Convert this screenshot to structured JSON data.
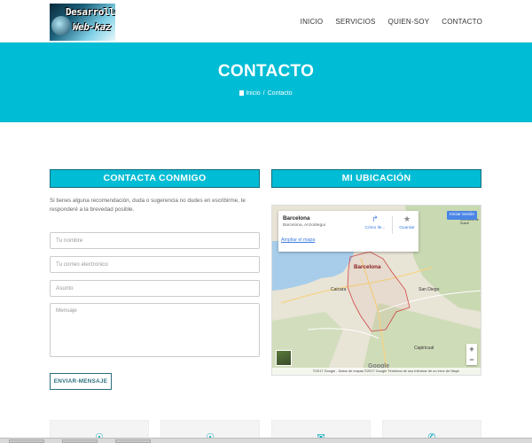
{
  "header": {
    "logo_line1": "Desarrollo",
    "logo_line2": "Web-kaz",
    "nav": [
      "INICIO",
      "SERVICIOS",
      "QUIEN-SOY",
      "CONTACTO"
    ]
  },
  "banner": {
    "title": "CONTACTO",
    "breadcrumb_home": "Inicio",
    "breadcrumb_sep": "/",
    "breadcrumb_current": "Contacto"
  },
  "contact": {
    "title": "CONTACTA CONMIGO",
    "intro": "Si tienes alguna recomendación, duda o sugerencia no dudes en escribirme, te responderé a la brevedad posible.",
    "name_placeholder": "Tu nombre",
    "email_placeholder": "Tu correo electronico",
    "subject_placeholder": "Asunto",
    "message_placeholder": "Mensaje",
    "send_label": "ENVIAR-MENSAJE"
  },
  "location": {
    "title": "MI UBICACIÓN",
    "place_name": "Barcelona",
    "place_sub": "Barcelona, Anzoátegui",
    "enlarge_link": "Ampliar el mapa",
    "directions_label": "Cómo lle...",
    "save_label": "Guardar",
    "login_label": "Iniciar sesión",
    "zoom_in": "+",
    "zoom_out": "−",
    "google_logo": "Google",
    "footer_text": "©2017 Google - Datos de mapas ©2017 Google    Términos de uso    Informar de un error de Maps",
    "labels": {
      "barcelona": "Barcelona",
      "caicara": "Caicara",
      "san_diego": "San Diego",
      "capiricual": "Capiricual",
      "los_altos": "Los Altos de Sucre"
    }
  },
  "colors": {
    "accent": "#00bcd4",
    "button_border": "#2a6f7c"
  }
}
